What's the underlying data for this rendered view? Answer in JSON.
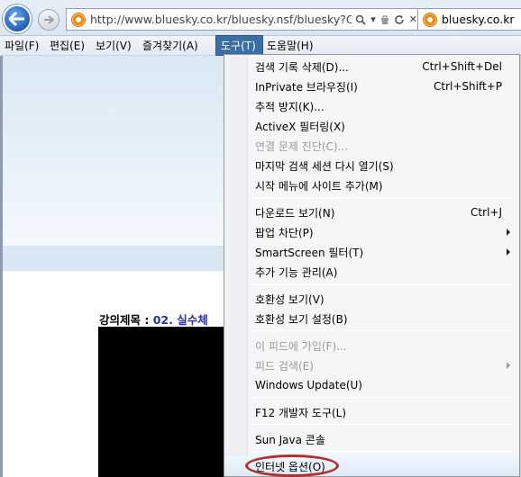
{
  "address_bar": {
    "url": "http://www.bluesky.co.kr/bluesky.nsf/bluesky?Ope",
    "tab_title": "bluesky.co.kr"
  },
  "menubar": {
    "items": [
      "파일(F)",
      "편집(E)",
      "보기(V)",
      "즐겨찾기(A)",
      "도구(T)",
      "도움말(H)"
    ],
    "active_index": 4
  },
  "page": {
    "lecture_label": "강의제목 : ",
    "lecture_value": "02. 실수체"
  },
  "tools_menu": {
    "items": [
      {
        "label": "검색 기록 삭제(D)...",
        "shortcut": "Ctrl+Shift+Del"
      },
      {
        "label": "InPrivate 브라우징(I)",
        "shortcut": "Ctrl+Shift+P"
      },
      {
        "label": "추적 방지(K)..."
      },
      {
        "label": "ActiveX 필터링(X)"
      },
      {
        "label": "연결 문제 진단(C)...",
        "disabled": true
      },
      {
        "label": "마지막 검색 세션 다시 열기(S)"
      },
      {
        "label": "시작 메뉴에 사이트 추가(M)"
      },
      {
        "label": "다운로드 보기(N)",
        "shortcut": "Ctrl+J"
      },
      {
        "label": "팝업 차단(P)",
        "submenu": true
      },
      {
        "label": "SmartScreen 필터(T)",
        "submenu": true
      },
      {
        "label": "추가 기능 관리(A)"
      },
      {
        "label": "호환성 보기(V)"
      },
      {
        "label": "호환성 보기 설정(B)"
      },
      {
        "label": "이 피드에 가입(F)...",
        "disabled": true
      },
      {
        "label": "피드 검색(E)",
        "disabled": true,
        "submenu": true
      },
      {
        "label": "Windows Update(U)"
      },
      {
        "label": "F12 개발자 도구(L)"
      },
      {
        "label": "Sun Java 콘솔"
      },
      {
        "label": "인터넷 옵션(O)",
        "highlighted": true
      }
    ]
  },
  "colors": {
    "menu_active": "#3a6ea5",
    "lecture_value": "#1f2fb3",
    "highlight_circle": "#b1302a"
  }
}
